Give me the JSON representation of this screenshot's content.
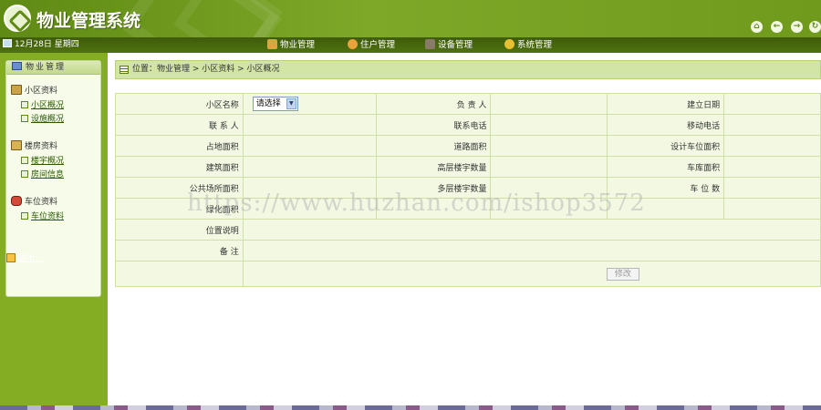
{
  "app": {
    "title": "物业管理系统"
  },
  "header_buttons": [
    {
      "icon": "home-icon",
      "symbol": "⌂"
    },
    {
      "icon": "back-icon",
      "symbol": "←"
    },
    {
      "icon": "forward-icon",
      "symbol": "→"
    },
    {
      "icon": "refresh-icon",
      "symbol": "↻"
    }
  ],
  "navbar": {
    "date": "12月28日 星期四",
    "items": [
      {
        "label": "物业管理",
        "icon": "house-icon",
        "color": "#d9a640"
      },
      {
        "label": "住户管理",
        "icon": "person-icon",
        "color": "#e8a33b"
      },
      {
        "label": "设备管理",
        "icon": "tools-icon",
        "color": "#8a7a6a"
      },
      {
        "label": "系统管理",
        "icon": "coins-icon",
        "color": "#e6c030"
      }
    ]
  },
  "sidebar": {
    "title": "物业管理",
    "groups": [
      {
        "label": "小区资料",
        "icon": "building-icon",
        "items": [
          "小区概况",
          "设施概况"
        ]
      },
      {
        "label": "楼房资料",
        "icon": "apartment-icon",
        "items": [
          "楼宇概况",
          "房间信息"
        ]
      },
      {
        "label": "车位资料",
        "icon": "car-icon",
        "items": [
          "车位资料"
        ]
      }
    ],
    "logout": "退出..."
  },
  "breadcrumb": "位置：物业管理 > 小区资料 > 小区概况",
  "form": {
    "rows": [
      [
        "小区名称",
        "",
        "负 责 人",
        "",
        "建立日期",
        ""
      ],
      [
        "联 系 人",
        "",
        "联系电话",
        "",
        "移动电话",
        ""
      ],
      [
        "占地面积",
        "",
        "道路面积",
        "",
        "设计车位面积",
        ""
      ],
      [
        "建筑面积",
        "",
        "高层楼宇数量",
        "",
        "车库面积",
        ""
      ],
      [
        "公共场所面积",
        "",
        "多层楼宇数量",
        "",
        "车 位 数",
        ""
      ],
      [
        "绿化面积",
        "",
        "",
        "",
        "",
        ""
      ]
    ],
    "select_value": "请选择",
    "location_label": "位置说明",
    "note_label": "备 注",
    "edit_button": "修改"
  },
  "watermark": "https://www.huzhan.com/ishop3572",
  "colors": {
    "accent": "#7ea828",
    "dark_nav": "#4f7210",
    "sidebar": "#84ad23",
    "form_bg": "#f2f8e2"
  }
}
